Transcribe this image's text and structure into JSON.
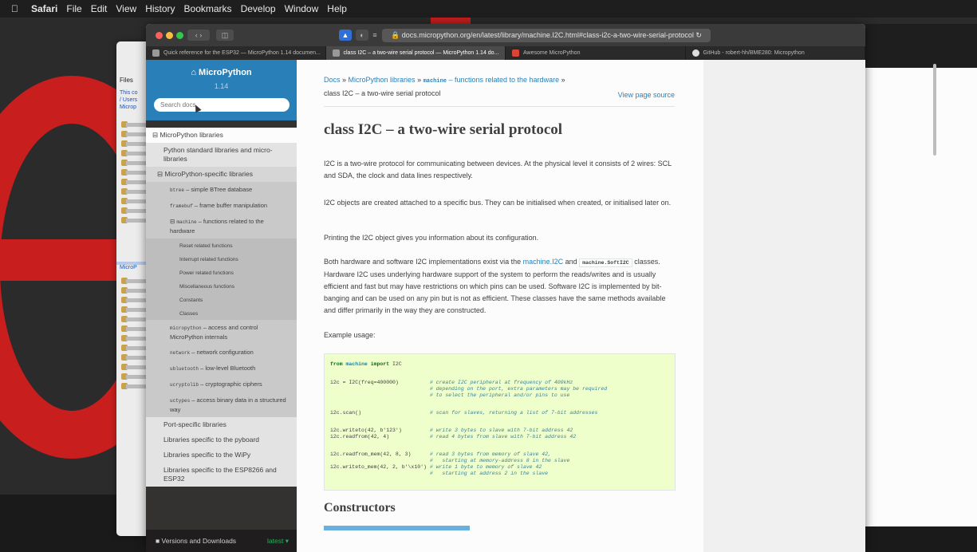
{
  "menubar": {
    "app": "Safari",
    "items": [
      "File",
      "Edit",
      "View",
      "History",
      "Bookmarks",
      "Develop",
      "Window",
      "Help"
    ]
  },
  "background_window": {
    "files_label": "Files",
    "path_lines": [
      "This co",
      "/ Users",
      "Microp"
    ],
    "section_label": "MicroP"
  },
  "browser": {
    "url": "docs.micropython.org/en/latest/library/machine.I2C.html#class-i2c-a-two-wire-serial-protocol",
    "tabs": [
      {
        "label": "Quick reference for the ESP32 — MicroPython 1.14 documen...",
        "active": false
      },
      {
        "label": "class I2C – a two-wire serial protocol — MicroPython 1.14 do...",
        "active": true
      },
      {
        "label": "Awesome MicroPython",
        "active": false
      },
      {
        "label": "GitHub - robert-hh/BME280: Micropython",
        "active": false
      }
    ]
  },
  "sidebar": {
    "brand": "MicroPython",
    "version": "1.14",
    "search_placeholder": "Search docs",
    "items": [
      {
        "level": "lvl1",
        "text": "MicroPython libraries",
        "prefix": "⊟ "
      },
      {
        "level": "lvl1b",
        "text": "Python standard libraries and micro-libraries"
      },
      {
        "level": "lvl2",
        "text": "MicroPython-specific libraries",
        "prefix": "⊟ "
      },
      {
        "level": "lvl3",
        "mono": "btree",
        "text": " – simple BTree database"
      },
      {
        "level": "lvl3",
        "mono": "framebuf",
        "text": " – frame buffer manipulation"
      },
      {
        "level": "lvl3",
        "mono": "machine",
        "text": " – functions related to the hardware",
        "prefix": "⊟ "
      },
      {
        "level": "lvl4",
        "text": "Reset related functions"
      },
      {
        "level": "lvl4",
        "text": "Interrupt related functions"
      },
      {
        "level": "lvl4",
        "text": "Power related functions"
      },
      {
        "level": "lvl4",
        "text": "Miscellaneous functions"
      },
      {
        "level": "lvl4",
        "text": "Constants"
      },
      {
        "level": "lvl4",
        "text": "Classes"
      },
      {
        "level": "lvl3",
        "mono": "micropython",
        "text": " – access and control MicroPython internals"
      },
      {
        "level": "lvl3",
        "mono": "network",
        "text": " – network configuration"
      },
      {
        "level": "lvl3",
        "mono": "ubluetooth",
        "text": " – low-level Bluetooth"
      },
      {
        "level": "lvl3",
        "mono": "ucryptolib",
        "text": " – cryptographic ciphers"
      },
      {
        "level": "lvl3",
        "mono": "uctypes",
        "text": " – access binary data in a structured way"
      },
      {
        "level": "lvl1b",
        "text": "Port-specific libraries"
      },
      {
        "level": "lvl1b",
        "text": "Libraries specific to the pyboard"
      },
      {
        "level": "lvl1b",
        "text": "Libraries specific to the WiPy"
      },
      {
        "level": "lvl1b",
        "text": "Libraries specific to the ESP8266 and ESP32"
      }
    ],
    "footer": "Versions and Downloads",
    "footer_version": "latest ▾"
  },
  "content": {
    "breadcrumb": {
      "docs": "Docs",
      "sep": " » ",
      "libs": "MicroPython libraries",
      "machine_mono": "machine",
      "machine_text": " – functions related to the hardware",
      "sep2": " »",
      "current": "class I2C – a two-wire serial protocol"
    },
    "view_source": "View page source",
    "title": "class I2C – a two-wire serial protocol",
    "p1": "I2C is a two-wire protocol for communicating between devices. At the physical level it consists of 2 wires: SCL and SDA, the clock and data lines respectively.",
    "p2": "I2C objects are created attached to a specific bus. They can be initialised when created, or initialised later on.",
    "p3": "Printing the I2C object gives you information about its configuration.",
    "p4_a": "Both hardware and software I2C implementations exist via the ",
    "p4_link": "machine.I2C",
    "p4_b": " and ",
    "p4_code": "machine.SoftI2C",
    "p4_c": " classes. Hardware I2C uses underlying hardware support of the system to perform the reads/writes and is usually efficient and fast but may have restrictions on which pins can be used. Software I2C is implemented by bit-banging and can be used on any pin but is not as efficient. These classes have the same methods available and differ primarily in the way they are constructed.",
    "p5": "Example usage:",
    "code": {
      "l1_kw1": "from",
      "l1_mod": " machine ",
      "l1_kw2": "import",
      "l1_rest": " I2C",
      "l2": "i2c = I2C(freq=400000)          ",
      "l2_c": "# create I2C peripheral at frequency of 400kHz",
      "l3_c": "# depending on the port, extra parameters may be required",
      "l4_c": "# to select the peripheral and/or pins to use",
      "l5": "i2c.scan()                      ",
      "l5_c": "# scan for slaves, returning a list of 7-bit addresses",
      "l6": "i2c.writeto(42, b'123')         ",
      "l6_c": "# write 3 bytes to slave with 7-bit address 42",
      "l7": "i2c.readfrom(42, 4)             ",
      "l7_c": "# read 4 bytes from slave with 7-bit address 42",
      "l8": "i2c.readfrom_mem(42, 8, 3)      ",
      "l8_c": "# read 3 bytes from memory of slave 42,",
      "l9_c": "#   starting at memory-address 8 in the slave",
      "l10": "i2c.writeto_mem(42, 2, b'\\x10') ",
      "l10_c": "# write 1 byte to memory of slave 42",
      "l11_c": "#   starting at address 2 in the slave"
    },
    "h2": "Constructors"
  }
}
